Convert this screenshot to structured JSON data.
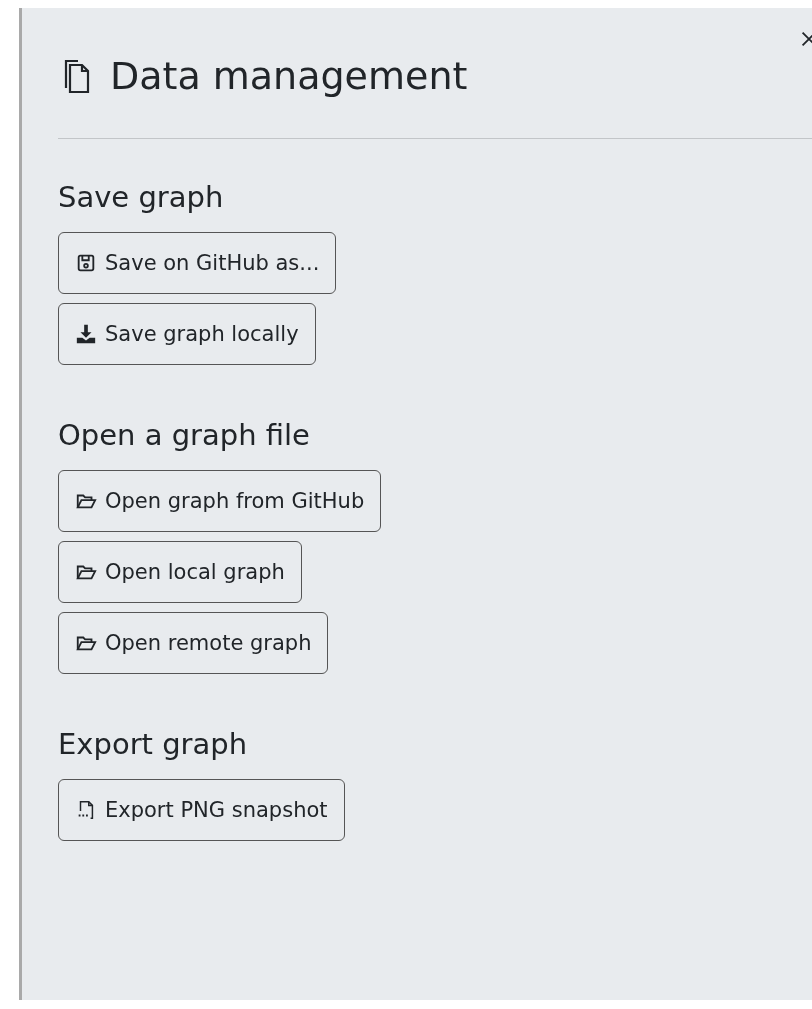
{
  "panel": {
    "title": "Data management"
  },
  "sections": [
    {
      "heading": "Save graph",
      "buttons": [
        {
          "label": "Save on GitHub as...",
          "kind": "save"
        },
        {
          "label": "Save graph locally",
          "kind": "download"
        }
      ]
    },
    {
      "heading": "Open a graph file",
      "buttons": [
        {
          "label": "Open graph from GitHub",
          "kind": "folder"
        },
        {
          "label": "Open local graph",
          "kind": "folder"
        },
        {
          "label": "Open remote graph",
          "kind": "folder"
        }
      ]
    },
    {
      "heading": "Export graph",
      "buttons": [
        {
          "label": "Export PNG snapshot",
          "kind": "png"
        }
      ]
    }
  ]
}
